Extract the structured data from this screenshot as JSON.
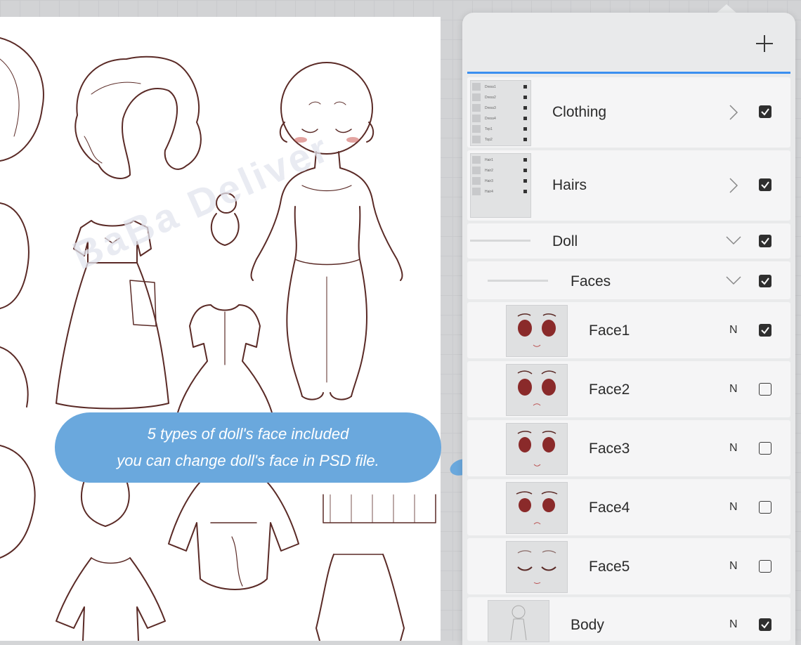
{
  "watermark": "BaBa Deliver",
  "callout": {
    "line1": "5 types of doll's face  included",
    "line2": "you can change doll's face in PSD file."
  },
  "layers_panel": {
    "add_icon": "plus-icon",
    "accent_color": "#3b8ff0",
    "rows": [
      {
        "name": "Clothing",
        "type": "group",
        "expanded": false,
        "visible": true,
        "thumb_items": [
          "Dress1",
          "Dress2",
          "Dress3",
          "Dress4",
          "Top1",
          "Top2"
        ]
      },
      {
        "name": "Hairs",
        "type": "group",
        "expanded": false,
        "visible": true,
        "thumb_items": [
          "Hair1",
          "Hair2",
          "Hair3",
          "Hair4"
        ]
      },
      {
        "name": "Doll",
        "type": "group",
        "expanded": true,
        "visible": true
      },
      {
        "name": "Faces",
        "type": "group",
        "expanded": true,
        "visible": true
      },
      {
        "name": "Face1",
        "type": "layer",
        "blend": "N",
        "visible": true
      },
      {
        "name": "Face2",
        "type": "layer",
        "blend": "N",
        "visible": false
      },
      {
        "name": "Face3",
        "type": "layer",
        "blend": "N",
        "visible": false
      },
      {
        "name": "Face4",
        "type": "layer",
        "blend": "N",
        "visible": false
      },
      {
        "name": "Face5",
        "type": "layer",
        "blend": "N",
        "visible": false
      },
      {
        "name": "Body",
        "type": "layer",
        "blend": "N",
        "visible": true
      }
    ]
  }
}
